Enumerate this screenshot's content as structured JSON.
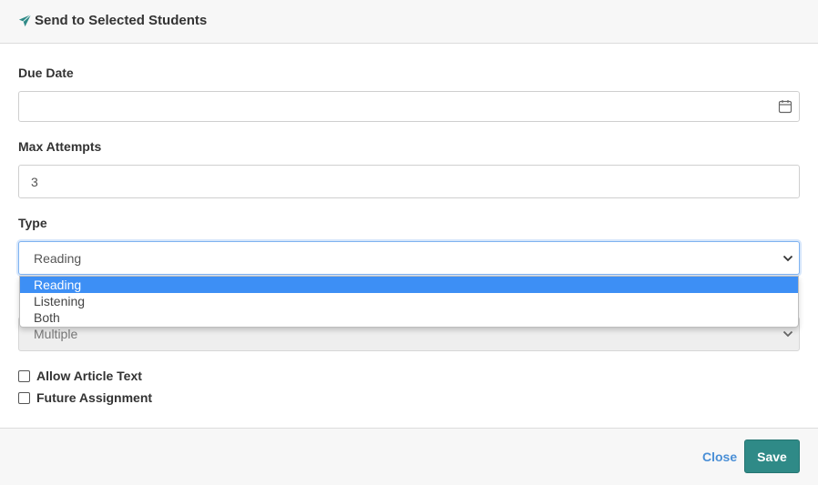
{
  "header": {
    "title": "Send to Selected Students",
    "icon": "paper-plane-icon",
    "icon_color": "#2f8a87"
  },
  "form": {
    "due_date": {
      "label": "Due Date",
      "value": "",
      "placeholder": "",
      "icon": "calendar-icon"
    },
    "max_attempts": {
      "label": "Max Attempts",
      "value": "3"
    },
    "type": {
      "label": "Type",
      "selected": "Reading",
      "options": [
        "Reading",
        "Listening",
        "Both"
      ],
      "highlighted_option": "Reading"
    },
    "hidden_select": {
      "selected": "Multiple",
      "disabled": true
    },
    "allow_article_text": {
      "label": "Allow Article Text",
      "checked": false
    },
    "future_assignment": {
      "label": "Future Assignment",
      "checked": false
    }
  },
  "footer": {
    "close_label": "Close",
    "save_label": "Save"
  },
  "colors": {
    "accent": "#2f8a87",
    "link": "#4a8fd6",
    "option_highlight": "#3d8ff5"
  }
}
